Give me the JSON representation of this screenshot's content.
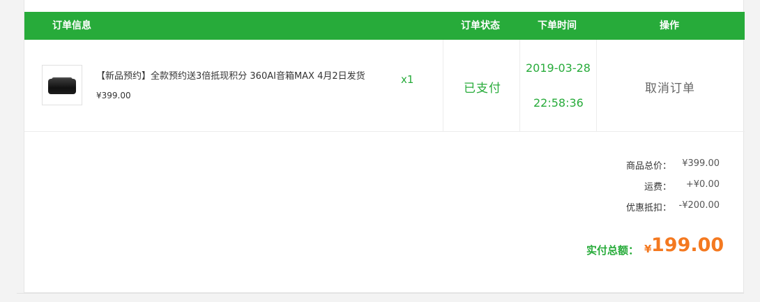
{
  "table": {
    "headers": {
      "info": "订单信息",
      "status": "订单状态",
      "time": "下单时间",
      "ops": "操作"
    }
  },
  "order": {
    "product_name": "【新品预约】全款预约送3倍抵现积分 360AI音箱MAX 4月2日发货",
    "price": "¥399.00",
    "quantity": "x1",
    "status": "已支付",
    "date": "2019-03-28",
    "time": "22:58:36",
    "cancel_label": "取消订单"
  },
  "summary": {
    "goods_total_label": "商品总价：",
    "goods_total_value": "¥399.00",
    "shipping_label": "运费：",
    "shipping_value": "+¥0.00",
    "discount_label": "优惠抵扣：",
    "discount_value": "-¥200.00",
    "paid_label": "实付总额：",
    "paid_currency": "¥",
    "paid_amount": "199.00"
  },
  "colors": {
    "accent_green": "#27ab3a",
    "total_orange": "#f47920"
  },
  "icons": {
    "product_thumbnail": "speaker-product-image"
  }
}
